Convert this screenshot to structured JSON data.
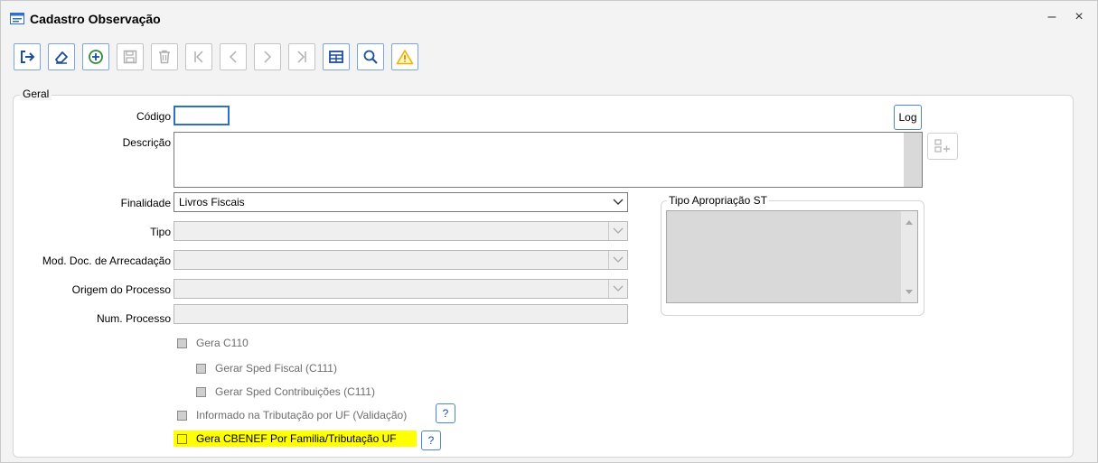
{
  "window": {
    "title": "Cadastro Observação",
    "minimize": "–",
    "close": "×"
  },
  "toolbar": {
    "buttons": [
      {
        "name": "exit",
        "icon": "exit-icon",
        "enabled": true
      },
      {
        "name": "clear",
        "icon": "eraser-icon",
        "enabled": true
      },
      {
        "name": "new",
        "icon": "add-circle-icon",
        "enabled": true
      },
      {
        "name": "save",
        "icon": "save-icon",
        "enabled": false
      },
      {
        "name": "delete",
        "icon": "trash-icon",
        "enabled": false
      },
      {
        "name": "first",
        "icon": "first-icon",
        "enabled": false
      },
      {
        "name": "previous",
        "icon": "previous-icon",
        "enabled": false
      },
      {
        "name": "next",
        "icon": "next-icon",
        "enabled": false
      },
      {
        "name": "last",
        "icon": "last-icon",
        "enabled": false
      },
      {
        "name": "grid",
        "icon": "table-icon",
        "enabled": true
      },
      {
        "name": "search",
        "icon": "search-icon",
        "enabled": true
      },
      {
        "name": "warning",
        "icon": "warning-icon",
        "enabled": true
      }
    ]
  },
  "geral": {
    "legend": "Geral",
    "codigo_label": "Código",
    "codigo_value": "",
    "log_label": "Log",
    "descricao_label": "Descrição",
    "descricao_value": "",
    "finalidade_label": "Finalidade",
    "finalidade_value": "Livros Fiscais",
    "tipo_label": "Tipo",
    "tipo_value": "",
    "mod_doc_label": "Mod. Doc. de Arrecadação",
    "mod_doc_value": "",
    "origem_label": "Origem do Processo",
    "origem_value": "",
    "num_processo_label": "Num. Processo",
    "num_processo_value": "",
    "tipo_apropriacao_legend": "Tipo Apropriação ST"
  },
  "checkboxes": {
    "gera_c110": "Gera C110",
    "sped_fiscal": "Gerar Sped Fiscal (C111)",
    "sped_contribuicoes": "Gerar Sped Contribuições (C111)",
    "informado_uf": "Informado na Tributação por UF (Validação)",
    "gera_cbenef": "Gera CBENEF Por Familia/Tributação UF",
    "help_label": "?"
  },
  "colors": {
    "accent": "#2e6fc7",
    "highlight": "#ffff00",
    "warning": "#f0b400",
    "add_green": "#2e8b3a"
  }
}
